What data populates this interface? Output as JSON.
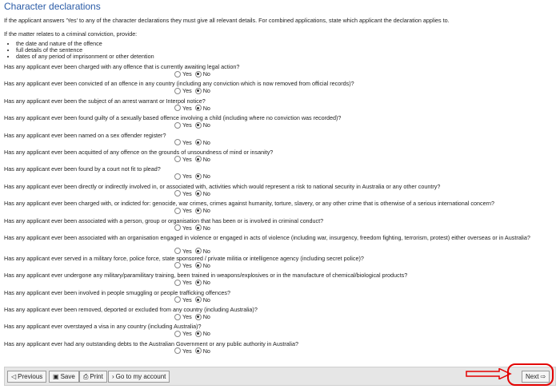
{
  "page": {
    "title": "Character declarations",
    "intro": "If the applicant answers 'Yes' to any of the character declarations they must give all relevant details. For combined applications, state which applicant the declaration applies to.",
    "conviction_intro": "If the matter relates to a criminal conviction, provide:",
    "conviction_items": [
      "the date and nature of the offence",
      "full details of the sentence",
      "dates of any period of imprisonment or other detention"
    ]
  },
  "options": {
    "yes": "Yes",
    "no": "No"
  },
  "questions": [
    {
      "text": "Has any applicant ever been charged with any offence that is currently awaiting legal action?",
      "selected": "No"
    },
    {
      "text": "Has any applicant ever been convicted of an offence in any country (including any conviction which is now removed from official records)?",
      "selected": "No"
    },
    {
      "text": "Has any applicant ever been the subject of an arrest warrant or Interpol notice?",
      "selected": "No"
    },
    {
      "text": "Has any applicant ever been found guilty of a sexually based offence involving a child (including where no conviction was recorded)?",
      "selected": "No"
    },
    {
      "text": "Has any applicant ever been named on a sex offender register?",
      "selected": "No"
    },
    {
      "text": "Has any applicant ever been acquitted of any offence on the grounds of unsoundness of mind or insanity?",
      "selected": "No"
    },
    {
      "text": "Has any applicant ever been found by a court not fit to plead?",
      "selected": "No"
    },
    {
      "text": "Has any applicant ever been directly or indirectly involved in, or associated with, activities which would represent a risk to national security in Australia or any other country?",
      "selected": "No"
    },
    {
      "text": "Has any applicant ever been charged with, or indicted for: genocide, war crimes, crimes against humanity, torture, slavery, or any other crime that is otherwise of a serious international concern?",
      "selected": "No"
    },
    {
      "text": "Has any applicant ever been associated with a person, group or organisation that has been or is involved in criminal conduct?",
      "selected": "No"
    },
    {
      "text": "Has any applicant ever been associated with an organisation engaged in violence or engaged in acts of violence (including war, insurgency, freedom fighting, terrorism, protest) either overseas or in Australia?",
      "selected": "No",
      "wrap": true
    },
    {
      "text": "Has any applicant ever served in a military force, police force, state sponsored / private militia or intelligence agency (including secret police)?",
      "selected": "No"
    },
    {
      "text": "Has any applicant ever undergone any military/paramilitary training, been trained in weapons/explosives or in the manufacture of chemical/biological products?",
      "selected": "No"
    },
    {
      "text": "Has any applicant ever been involved in people smuggling or people trafficking offences?",
      "selected": "No"
    },
    {
      "text": "Has any applicant ever been removed, deported or excluded from any country (including Australia)?",
      "selected": "No"
    },
    {
      "text": "Has any applicant ever overstayed a visa in any country (including Australia)?",
      "selected": "No"
    },
    {
      "text": "Has any applicant ever had any outstanding debts to the Australian Government or any public authority in Australia?",
      "selected": "No"
    }
  ],
  "footer": {
    "previous": "Previous",
    "save": "Save",
    "print": "Print",
    "goto_account": "Go to my account",
    "next": "Next"
  },
  "colors": {
    "title": "#2a5ba6",
    "annotation": "#e30000"
  }
}
